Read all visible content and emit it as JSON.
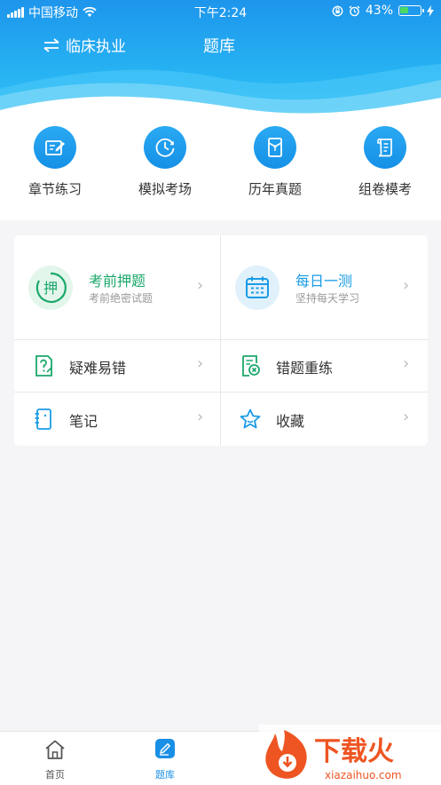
{
  "status_bar": {
    "carrier": "中国移动",
    "time": "下午2:24",
    "battery_percent": "43%",
    "battery_level": 0.43
  },
  "header": {
    "profession": "临床执业",
    "title": "题库"
  },
  "quick_access": [
    {
      "label": "章节练习",
      "icon": "edit-note-icon"
    },
    {
      "label": "模拟考场",
      "icon": "clock-icon"
    },
    {
      "label": "历年真题",
      "icon": "archive-file-icon"
    },
    {
      "label": "组卷模考",
      "icon": "scroll-icon"
    }
  ],
  "features": {
    "exam_predict": {
      "title": "考前押题",
      "subtitle": "考前绝密试题",
      "icon_text": "押",
      "color": "#1aa86a"
    },
    "daily_test": {
      "title": "每日一测",
      "subtitle": "坚持每天学习",
      "color": "#1a9be6"
    },
    "difficult": {
      "label": "疑难易错",
      "icon": "question-doc-icon"
    },
    "wrong_retry": {
      "label": "错题重练",
      "icon": "wrong-doc-icon"
    },
    "notes": {
      "label": "笔记",
      "icon": "notebook-icon"
    },
    "favorites": {
      "label": "收藏",
      "icon": "star-icon"
    }
  },
  "tab_bar": {
    "home": "首页",
    "question_bank": "题库",
    "active": "question_bank",
    "active_color": "#1a8fe6"
  },
  "watermark": {
    "brand": "下载火",
    "domain": "xiazaihuo.com"
  }
}
